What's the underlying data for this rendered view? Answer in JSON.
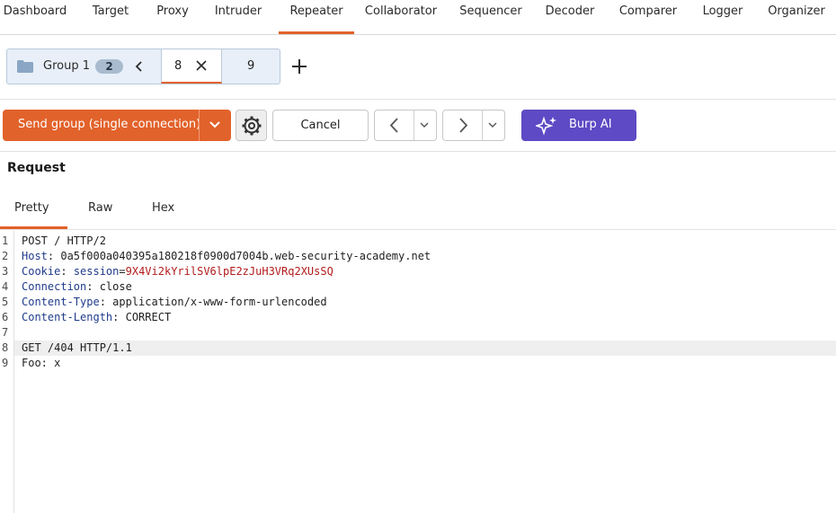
{
  "nav": {
    "tabs": [
      "Dashboard",
      "Target",
      "Proxy",
      "Intruder",
      "Repeater",
      "Collaborator",
      "Sequencer",
      "Decoder",
      "Comparer",
      "Logger",
      "Organizer"
    ],
    "active": "Repeater"
  },
  "group": {
    "label": "Group 1",
    "count": "2",
    "tab_8": "8",
    "tab_9": "9"
  },
  "toolbar": {
    "send_label": "Send group (single connection)",
    "cancel_label": "Cancel",
    "burp_ai_label": "Burp AI"
  },
  "request": {
    "title": "Request",
    "subtabs": [
      "Pretty",
      "Raw",
      "Hex"
    ],
    "active_subtab": "Pretty",
    "line_numbers": [
      "1",
      "2",
      "3",
      "4",
      "5",
      "6",
      "7",
      "8",
      "9"
    ],
    "lines": {
      "l1": "POST / HTTP/2",
      "l2_key": "Host",
      "l2_val": ": 0a5f000a040395a180218f0900d7004b.web-security-academy.net",
      "l3_key": "Cookie",
      "l3_sep": ": ",
      "l3_ckey": "session",
      "l3_eq": "=",
      "l3_cval": "9X4Vi2kYrilSV6lpE2zJuH3VRq2XUsSQ",
      "l4_key": "Connection",
      "l4_val": ": close",
      "l5_key": "Content-Type",
      "l5_val": ": application/x-www-form-urlencoded",
      "l6_key": "Content-Length",
      "l6_val": ": CORRECT",
      "l8": "GET /404 HTTP/1.1",
      "l9": "Foo: x"
    }
  },
  "colors": {
    "accent": "#e2622b",
    "burp_ai": "#5d4ac4",
    "header_key": "#203b8c",
    "cookie_value": "#b31b1b"
  }
}
